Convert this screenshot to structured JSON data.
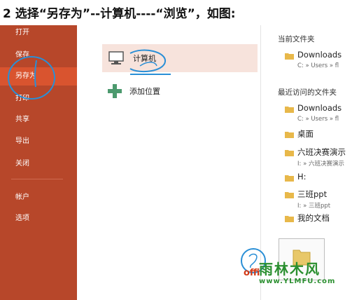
{
  "caption": "2 选择“另存为”--计算机----“浏览”，如图:",
  "sidebar": {
    "items": [
      {
        "label": "打开"
      },
      {
        "label": "保存"
      },
      {
        "label": "另存为"
      },
      {
        "label": "打印"
      },
      {
        "label": "共享"
      },
      {
        "label": "导出"
      },
      {
        "label": "关闭"
      },
      {
        "label": "帐户"
      },
      {
        "label": "选项"
      }
    ],
    "active_index": 2
  },
  "locations": [
    {
      "label": "计算机",
      "icon": "computer-icon"
    },
    {
      "label": "添加位置",
      "icon": "plus-icon"
    }
  ],
  "current_folder": {
    "title": "当前文件夹",
    "items": [
      {
        "name": "Downloads",
        "path": "C: » Users » fl"
      }
    ]
  },
  "recent_folders": {
    "title": "最近访问的文件夹",
    "items": [
      {
        "name": "Downloads",
        "path": "C: » Users » fl"
      },
      {
        "name": "桌面",
        "path": ""
      },
      {
        "name": "六班决赛演示",
        "path": "I: » 六班决赛演示"
      },
      {
        "name": "H:",
        "path": ""
      },
      {
        "name": "三班ppt",
        "path": "I: » 三班ppt"
      },
      {
        "name": "我的文档",
        "path": ""
      }
    ]
  },
  "watermark": {
    "logo": "雨林木风",
    "url": "www.YLMFU.com",
    "office": "offi"
  },
  "colors": {
    "sidebar": "#b7472a",
    "sidebar_active": "#d9542f",
    "selected_row": "#f7e3dc",
    "folder": "#e8b84a",
    "annotation": "#2a8fd6"
  }
}
